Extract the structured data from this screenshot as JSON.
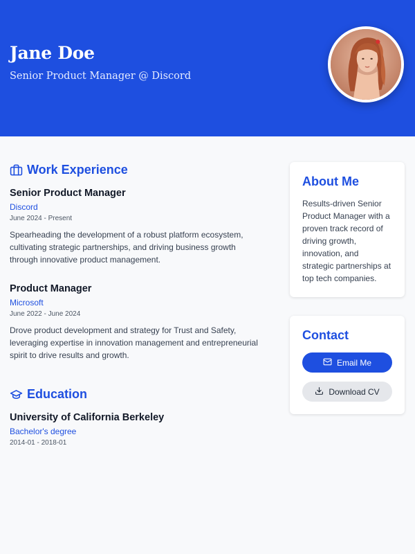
{
  "header": {
    "name": "Jane Doe",
    "tagline": "Senior Product Manager @ Discord"
  },
  "colors": {
    "accent": "#1e4fe0",
    "background": "#f8f9fb"
  },
  "work": {
    "title": "Work Experience",
    "icon": "briefcase-icon",
    "jobs": [
      {
        "title": "Senior Product Manager",
        "company": "Discord",
        "dates": "June 2024 - Present",
        "description": "Spearheading the development of a robust platform ecosystem, cultivating strategic partnerships, and driving business growth through innovative product management."
      },
      {
        "title": "Product Manager",
        "company": "Microsoft",
        "dates": "June 2022 - June 2024",
        "description": "Drove product development and strategy for Trust and Safety, leveraging expertise in innovation management and entrepreneurial spirit to drive results and growth."
      }
    ]
  },
  "education": {
    "title": "Education",
    "icon": "graduation-cap-icon",
    "items": [
      {
        "school": "University of California Berkeley",
        "degree": "Bachelor's degree",
        "dates": "2014-01 - 2018-01"
      }
    ]
  },
  "about": {
    "title": "About Me",
    "text": "Results-driven Senior Product Manager with a proven track record of driving growth, innovation, and strategic partnerships at top tech companies."
  },
  "contact": {
    "title": "Contact",
    "email_label": "Email Me",
    "email_icon": "mail-icon",
    "download_label": "Download CV",
    "download_icon": "download-icon"
  }
}
